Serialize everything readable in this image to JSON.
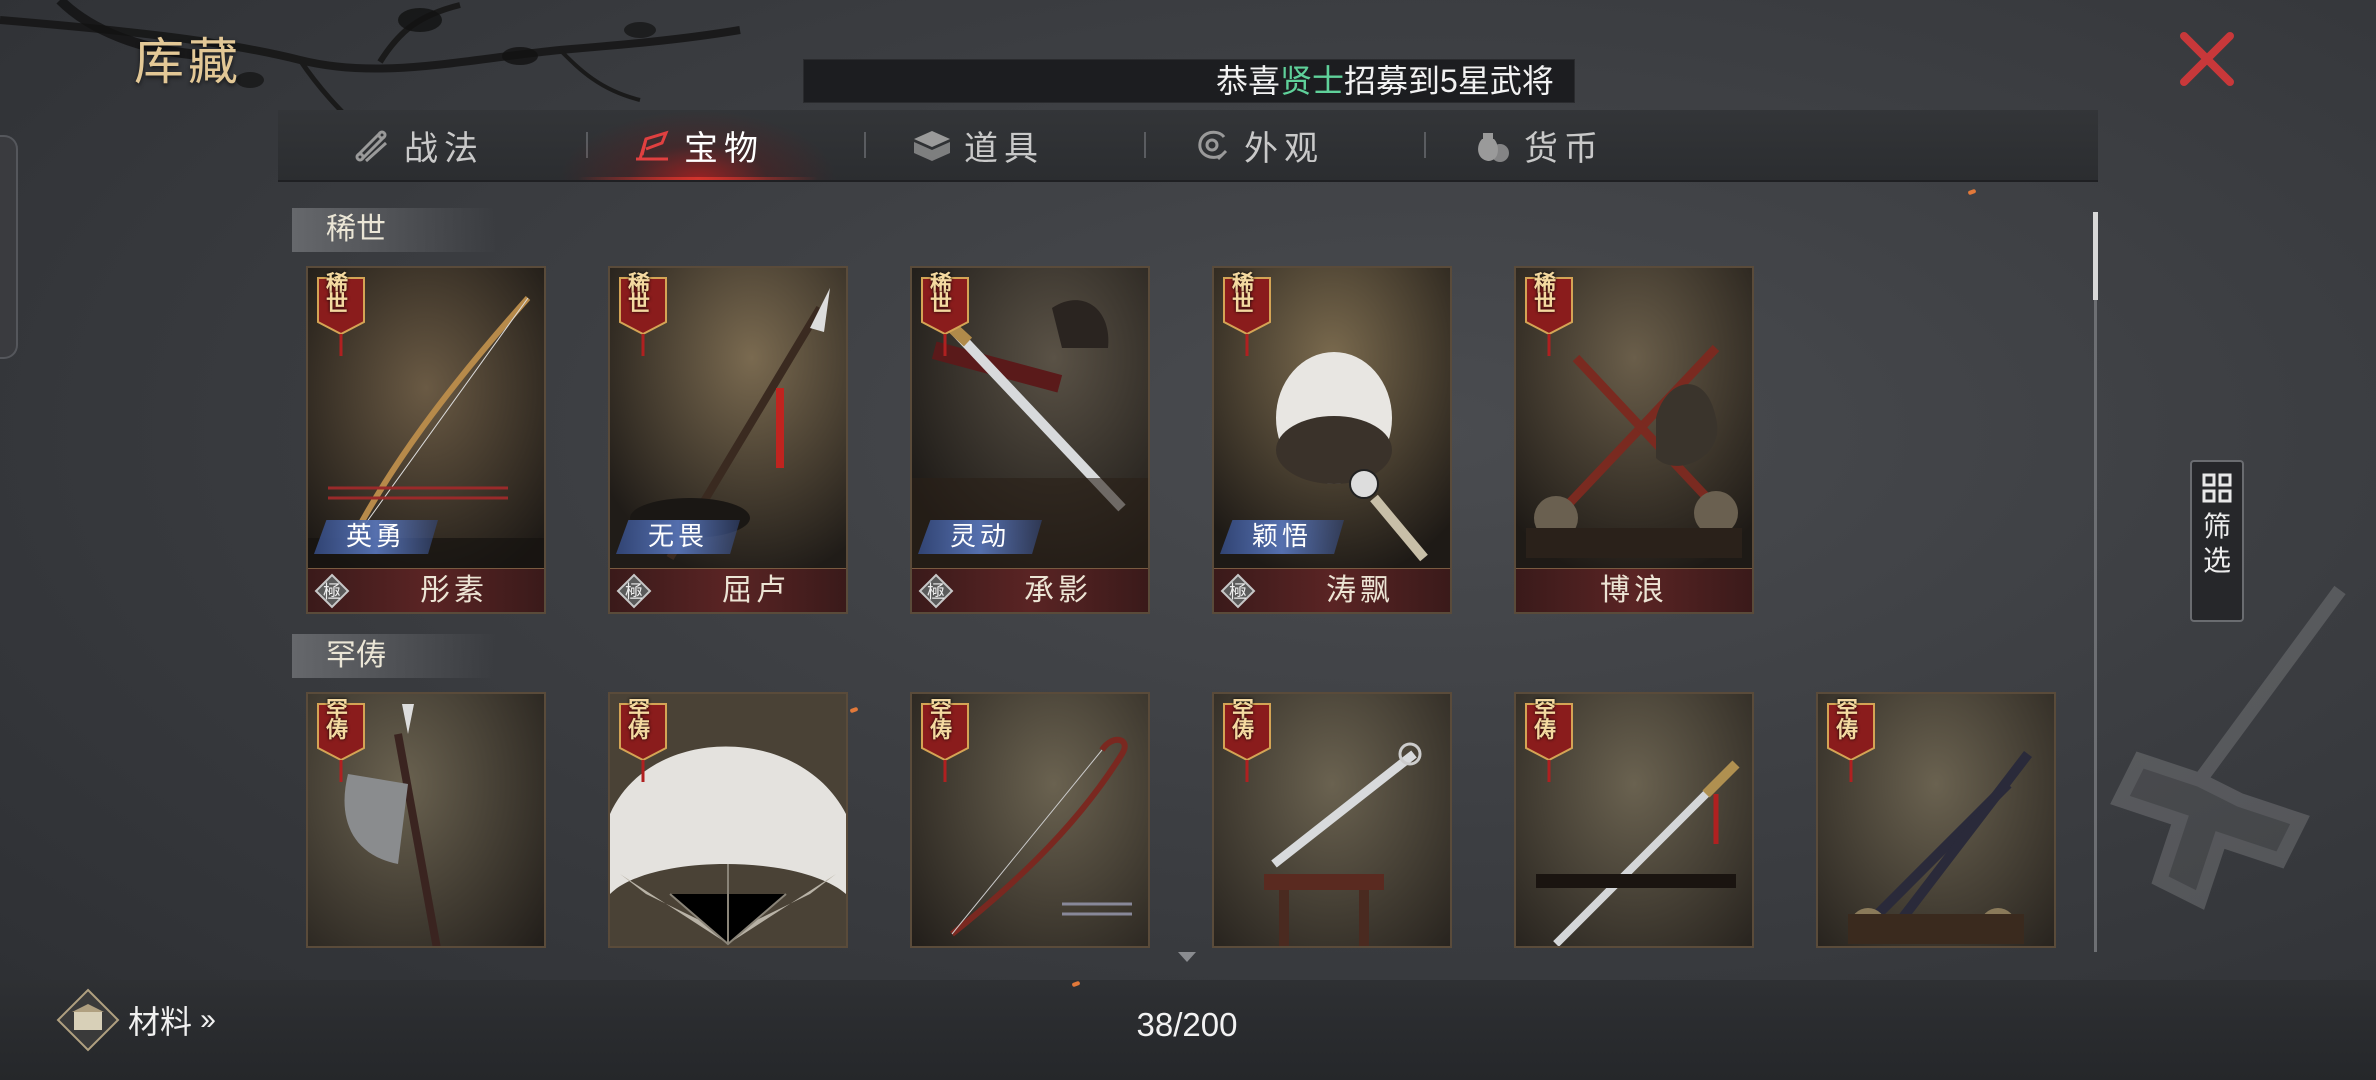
{
  "header": {
    "title": "库藏",
    "ticker": {
      "prefix": "恭喜",
      "highlight": "贤士",
      "suffix": "招募到5星武将"
    }
  },
  "tabs": [
    {
      "label": "战法",
      "icon": "scroll-bundle-icon",
      "active": false
    },
    {
      "label": "宝物",
      "icon": "treasure-icon",
      "active": true
    },
    {
      "label": "道具",
      "icon": "item-box-icon",
      "active": false
    },
    {
      "label": "外观",
      "icon": "swirl-icon",
      "active": false
    },
    {
      "label": "货币",
      "icon": "coin-bag-icon",
      "active": false
    }
  ],
  "sections": [
    {
      "title": "稀世",
      "rarity_chars": "稀世",
      "items": [
        {
          "name": "彤素",
          "trait": "英勇",
          "grade": "極",
          "art": "bow"
        },
        {
          "name": "屈卢",
          "trait": "无畏",
          "grade": "極",
          "art": "spear"
        },
        {
          "name": "承影",
          "trait": "灵动",
          "grade": "極",
          "art": "sword"
        },
        {
          "name": "涛飘",
          "trait": "颖悟",
          "grade": "極",
          "art": "fan"
        },
        {
          "name": "博浪",
          "trait": "",
          "grade": "",
          "art": "maces"
        }
      ]
    },
    {
      "title": "罕俦",
      "rarity_chars": "罕俦",
      "items": [
        {
          "art": "axe"
        },
        {
          "art": "feather-fan"
        },
        {
          "art": "bow2"
        },
        {
          "art": "sword-stand"
        },
        {
          "art": "katana"
        },
        {
          "art": "crossed-maces"
        }
      ]
    }
  ],
  "filter": {
    "label": "筛选"
  },
  "footer": {
    "materials_label": "材料",
    "capacity": "38/200"
  },
  "colors": {
    "accent_red": "#d2352d",
    "gold": "#e3c896",
    "ticker_green": "#5fd19a"
  }
}
